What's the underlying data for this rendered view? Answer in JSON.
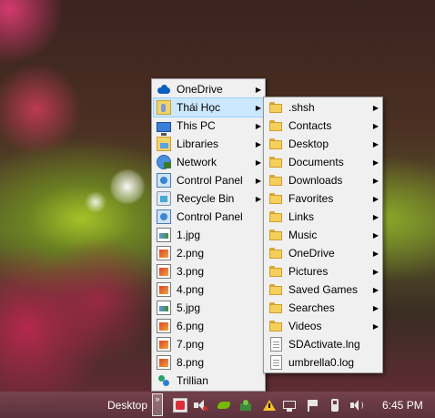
{
  "main_menu": {
    "items": [
      {
        "label": "OneDrive",
        "icon": "onedrive-cloud-icon",
        "submenu": true
      },
      {
        "label": "Thái Học",
        "icon": "user-folder-icon",
        "submenu": true,
        "highlighted": true
      },
      {
        "label": "This PC",
        "icon": "computer-icon",
        "submenu": true
      },
      {
        "label": "Libraries",
        "icon": "libraries-icon",
        "submenu": true
      },
      {
        "label": "Network",
        "icon": "network-icon",
        "submenu": true
      },
      {
        "label": "Control Panel",
        "icon": "control-panel-icon",
        "submenu": true
      },
      {
        "label": "Recycle Bin",
        "icon": "recycle-bin-icon",
        "submenu": true
      },
      {
        "label": "Control Panel",
        "icon": "control-panel-icon",
        "submenu": false
      },
      {
        "label": "1.jpg",
        "icon": "jpg-file-icon",
        "submenu": false
      },
      {
        "label": "2.png",
        "icon": "png-file-icon",
        "submenu": false
      },
      {
        "label": "3.png",
        "icon": "png-file-icon",
        "submenu": false
      },
      {
        "label": "4.png",
        "icon": "png-file-icon",
        "submenu": false
      },
      {
        "label": "5.jpg",
        "icon": "jpg-file-icon",
        "submenu": false
      },
      {
        "label": "6.png",
        "icon": "png-file-icon",
        "submenu": false
      },
      {
        "label": "7.png",
        "icon": "png-file-icon",
        "submenu": false
      },
      {
        "label": "8.png",
        "icon": "png-file-icon",
        "submenu": false
      },
      {
        "label": "Trillian",
        "icon": "trillian-icon",
        "submenu": false
      }
    ]
  },
  "sub_menu": {
    "items": [
      {
        "label": ".shsh",
        "icon": "folder-icon",
        "submenu": true
      },
      {
        "label": "Contacts",
        "icon": "folder-icon",
        "submenu": true
      },
      {
        "label": "Desktop",
        "icon": "folder-icon",
        "submenu": true
      },
      {
        "label": "Documents",
        "icon": "folder-icon",
        "submenu": true
      },
      {
        "label": "Downloads",
        "icon": "folder-icon",
        "submenu": true
      },
      {
        "label": "Favorites",
        "icon": "folder-icon",
        "submenu": true
      },
      {
        "label": "Links",
        "icon": "folder-icon",
        "submenu": true
      },
      {
        "label": "Music",
        "icon": "folder-icon",
        "submenu": true
      },
      {
        "label": "OneDrive",
        "icon": "folder-icon",
        "submenu": true
      },
      {
        "label": "Pictures",
        "icon": "folder-icon",
        "submenu": true
      },
      {
        "label": "Saved Games",
        "icon": "folder-icon",
        "submenu": true
      },
      {
        "label": "Searches",
        "icon": "folder-icon",
        "submenu": true
      },
      {
        "label": "Videos",
        "icon": "folder-icon",
        "submenu": true
      },
      {
        "label": "SDActivate.lng",
        "icon": "document-icon",
        "submenu": false
      },
      {
        "label": "umbrella0.log",
        "icon": "document-icon",
        "submenu": false
      }
    ]
  },
  "taskbar": {
    "toolbar_label": "Desktop",
    "chevron": "»",
    "clock": "6:45 PM",
    "tray_icons": [
      "vivaldi-icon",
      "speaker-muted-icon",
      "nvidia-icon",
      "network-share-icon",
      "warning-icon",
      "usb-icon",
      "network-status-icon",
      "action-center-flag-icon",
      "power-icon",
      "volume-icon"
    ]
  },
  "colors": {
    "menu_background": "#f0f0f0",
    "menu_highlight": "#cce8ff",
    "taskbar": "#7a4654"
  }
}
